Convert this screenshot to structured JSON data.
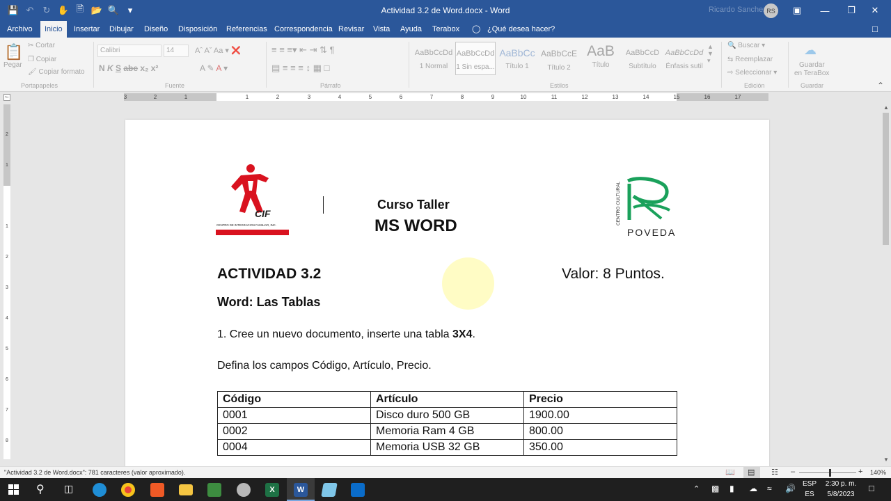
{
  "window": {
    "title": "Actividad 3.2 de Word.docx  -  Word",
    "user_name": "Ricardo Sanchez",
    "user_initials": "RS"
  },
  "menu": [
    "Archivo",
    "Inicio",
    "Insertar",
    "Dibujar",
    "Diseño",
    "Disposición",
    "Referencias",
    "Correspondencia",
    "Revisar",
    "Vista",
    "Ayuda",
    "Terabox"
  ],
  "search": {
    "label": "¿Qué desea hacer?"
  },
  "ribbon": {
    "clipboard": {
      "paste": "Pegar",
      "cut": "Cortar",
      "copy": "Copiar",
      "format_painter": "Copiar formato",
      "group": "Portapapeles"
    },
    "font": {
      "name": "Calibri",
      "size": "14",
      "group": "Fuente"
    },
    "paragraph": {
      "group": "Párrafo"
    },
    "styles": {
      "group": "Estilos",
      "items": [
        {
          "preview": "AaBbCcDd",
          "name": "1 Normal"
        },
        {
          "preview": "AaBbCcDd",
          "name": "1 Sin espa..."
        },
        {
          "preview": "AaBbCc",
          "name": "Título 1"
        },
        {
          "preview": "AaBbCcE",
          "name": "Título 2"
        },
        {
          "preview": "AaB",
          "name": "Título"
        },
        {
          "preview": "AaBbCcD",
          "name": "Subtítulo"
        },
        {
          "preview": "AaBbCcDd",
          "name": "Énfasis sutil"
        }
      ]
    },
    "editing": {
      "find": "Buscar",
      "replace": "Reemplazar",
      "select": "Seleccionar",
      "group": "Edición"
    },
    "save": {
      "line1": "Guardar",
      "line2": "en TeraBox",
      "group": "Guardar"
    }
  },
  "ruler": {
    "h": [
      "3",
      "2",
      "1",
      "1",
      "2",
      "3",
      "4",
      "5",
      "6",
      "7",
      "8",
      "9",
      "10",
      "11",
      "12",
      "13",
      "14",
      "15",
      "16",
      "17"
    ],
    "v": [
      "2",
      "1",
      "1",
      "2",
      "3",
      "4",
      "5",
      "6",
      "7",
      "8"
    ]
  },
  "document": {
    "logo_left_text": "CIF",
    "logo_left_caption": "CENTRO DE INTEGRACION FAMILIAR, INC.",
    "logo_right_vertical": "CENTRO CULTURAL",
    "logo_right_text": "POVEDA",
    "subtitle": "Curso Taller",
    "title": "MS WORD",
    "activity": "ACTIVIDAD 3.2",
    "value": "Valor: 8 Puntos.",
    "heading": "Word: Las Tablas",
    "step1_prefix": "1. Cree un nuevo documento, inserte una tabla ",
    "step1_bold": "3X4",
    "step1_suffix": ".",
    "step2": "Defina los campos Código, Artículo, Precio.",
    "table": {
      "headers": [
        "Código",
        "Artículo",
        "Precio"
      ],
      "rows": [
        [
          "0001",
          "Disco duro 500 GB",
          "1900.00"
        ],
        [
          "0002",
          "Memoria Ram 4 GB",
          "800.00"
        ],
        [
          "0004",
          "Memoria USB 32 GB",
          "350.00"
        ]
      ]
    }
  },
  "status": {
    "text": "\"Actividad 3.2 de Word.docx\": 781 caracteres (valor aproximado).",
    "zoom": "140%"
  },
  "taskbar": {
    "lang1": "ESP",
    "lang2": "ES",
    "time": "2:30 p. m.",
    "date": "5/8/2023"
  },
  "colors": {
    "word_blue": "#2b579a",
    "cif_red": "#d9121f",
    "poveda_green": "#1aa15b"
  }
}
